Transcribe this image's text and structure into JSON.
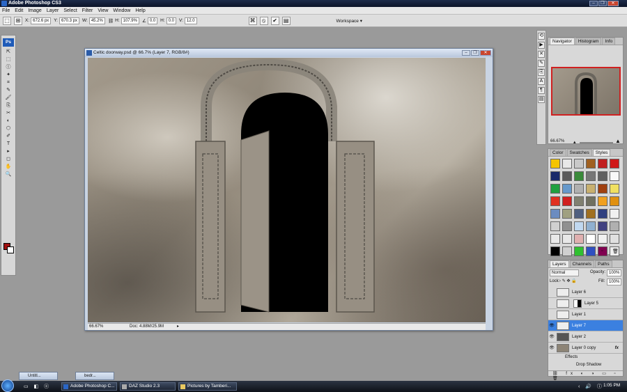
{
  "app": {
    "title": "Adobe Photoshop CS3"
  },
  "window_controls": [
    "–",
    "❐",
    "✕"
  ],
  "menu": [
    "File",
    "Edit",
    "Image",
    "Layer",
    "Select",
    "Filter",
    "View",
    "Window",
    "Help"
  ],
  "options": {
    "x_label": "X:",
    "x_value": "672.6 px",
    "y_label": "Y:",
    "y_value": "670.3 px",
    "w_label": "W:",
    "w_value": "45.2%",
    "h_label": "H:",
    "h_value": "107.9%",
    "angle_value": "0.0",
    "hskew_label": "H:",
    "hskew_value": "0.0",
    "vskew_label": "V:",
    "vskew_value": "12.0",
    "workspace_label": "Workspace ▾"
  },
  "tools": {
    "ps_label": "Ps",
    "items": [
      "⇱",
      "⬚",
      "ⓛ",
      "✦",
      "⌗",
      "✎",
      "🖌",
      "⎘",
      "✂",
      "◐",
      "⬡",
      "✐",
      "T",
      "▸",
      "◻",
      "✋",
      "🔍"
    ]
  },
  "document": {
    "title": "Celtic doorway.psd @ 66.7% (Layer 7, RGB/8#)",
    "zoom": "66.67%",
    "doc_size": "Doc: 4.88M/25.9M"
  },
  "navigator_panel": {
    "tabs": [
      "Navigator",
      "Histogram",
      "Info"
    ],
    "zoom": "66.67%"
  },
  "styles_panel": {
    "tabs": [
      "Color",
      "Swatches",
      "Styles"
    ],
    "swatch_colors": [
      "#f4c400",
      "#e8e8e8",
      "#c9c9c9",
      "#a06020",
      "#c02020",
      "#d01818",
      "#1a2a6a",
      "#5a5a5a",
      "#3a8a3a",
      "#777777",
      "#606060",
      "#f8f8f8",
      "#20a040",
      "#6699cc",
      "#b0b0b0",
      "#c8b070",
      "#a04010",
      "#f0e060",
      "#e03020",
      "#d02020",
      "#808070",
      "#707060",
      "#f0a020",
      "#e09010",
      "#6c8cc0",
      "#a0a080",
      "#506080",
      "#a07020",
      "#304080",
      "#f0f0f0",
      "#d0d0d0",
      "#909090",
      "#c0d8f0",
      "#90b0d0",
      "#404080",
      "#b0b0b0",
      "#e8e8e8",
      "#e8e8e8",
      "#e0b0b0",
      "#ffffff",
      "#f0f0f0",
      "#e0e0e0",
      "#000000",
      "#d0d0d0",
      "#30c030",
      "#3050c0",
      "#800050",
      "#eeeeee"
    ]
  },
  "layers_panel": {
    "tabs": [
      "Layers",
      "Channels",
      "Paths"
    ],
    "blend_mode": "Normal",
    "opacity_label": "Opacity:",
    "opacity": "100%",
    "lock_label": "Lock:",
    "fill_label": "Fill:",
    "fill": "100%",
    "layers": [
      {
        "name": "Layer 6",
        "selected": false
      },
      {
        "name": "Layer 5",
        "selected": false
      },
      {
        "name": "Layer 1",
        "selected": false
      },
      {
        "name": "Layer 7",
        "selected": true
      },
      {
        "name": "Layer 2",
        "selected": false
      },
      {
        "name": "Layer 0 copy",
        "selected": false
      }
    ],
    "effects_label": "Effects",
    "effect_name": "Drop Shadow"
  },
  "minimized": [
    "Untitl...",
    "bedr..."
  ],
  "taskbar": {
    "buttons": [
      "Adobe Photoshop C...",
      "DAZ Studio 2.3",
      "Pictures by Tamberi..."
    ],
    "clock": "1:05 PM"
  },
  "accent_color": "#3b80e0"
}
